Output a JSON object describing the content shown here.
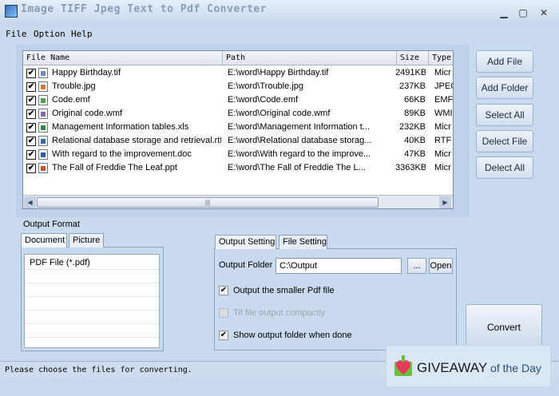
{
  "window": {
    "title": "Image TIFF Jpeg Text to Pdf Converter",
    "minimize": "▁",
    "maximize": "▢",
    "close": "✕"
  },
  "menu": [
    "File",
    "Option",
    "Help"
  ],
  "table": {
    "columns": [
      "File Name",
      "Path",
      "Size",
      "Type"
    ],
    "rows": [
      {
        "checked": "✔",
        "name": "Happy Birthday.tif",
        "path": "E:\\word\\Happy Birthday.tif",
        "size": "2491KB",
        "type": "Micr",
        "icon_color": "#6a8cc0"
      },
      {
        "checked": "✔",
        "name": "Trouble.jpg",
        "path": "E:\\word\\Trouble.jpg",
        "size": "237KB",
        "type": "JPEG",
        "icon_color": "#d07a3a"
      },
      {
        "checked": "✔",
        "name": "Code.emf",
        "path": "E:\\word\\Code.emf",
        "size": "66KB",
        "type": "EMF",
        "icon_color": "#4aa050"
      },
      {
        "checked": "✔",
        "name": "Original code.wmf",
        "path": "E:\\word\\Original code.wmf",
        "size": "89KB",
        "type": "WMI",
        "icon_color": "#8a60b0"
      },
      {
        "checked": "✔",
        "name": "Management Information tables.xls",
        "path": "E:\\word\\Management Information t...",
        "size": "232KB",
        "type": "Micr",
        "icon_color": "#2e8a3e"
      },
      {
        "checked": "✔",
        "name": "Relational database storage and retrieval.rtf",
        "path": "E:\\word\\Relational database storag...",
        "size": "40KB",
        "type": "RTF",
        "icon_color": "#3a6ab0"
      },
      {
        "checked": "✔",
        "name": "With regard to the improvement.doc",
        "path": "E:\\word\\With regard to the improve...",
        "size": "47KB",
        "type": "Micr",
        "icon_color": "#2c5aa8"
      },
      {
        "checked": "✔",
        "name": "The Fall of  Freddie The Leaf.ppt",
        "path": "E:\\word\\The Fall of  Freddie The L...",
        "size": "3363KB",
        "type": "Micr",
        "icon_color": "#d0502a"
      }
    ],
    "scroll_left": "◀",
    "scroll_right": "▶",
    "scroll_grip": "|||"
  },
  "side_buttons": {
    "add_file": "Add File",
    "add_folder": "Add Folder",
    "select_all": "Select All",
    "delete_file": "Delect File",
    "delete_all": "Delect All"
  },
  "output_format": {
    "label": "Output Format",
    "tabs": [
      "Document",
      "Picture"
    ],
    "items": [
      "PDF File  (*.pdf)"
    ]
  },
  "output_setting": {
    "tabs": [
      "Output Setting",
      "File Setting"
    ],
    "folder_label": "Output Folder",
    "folder_value": "C:\\Output",
    "browse": "...",
    "open": "Open",
    "opt_smaller": {
      "label": "Output the smaller Pdf file",
      "checked": "✔"
    },
    "opt_compact": {
      "label": "Tif file output compactly",
      "checked": ""
    },
    "opt_show": {
      "label": "Show output folder when done",
      "checked": "✔"
    }
  },
  "convert": "Convert",
  "status": "Please choose the files for converting.",
  "watermark": {
    "brand": "GIVEAWAY",
    "suffix": " of the Day"
  }
}
